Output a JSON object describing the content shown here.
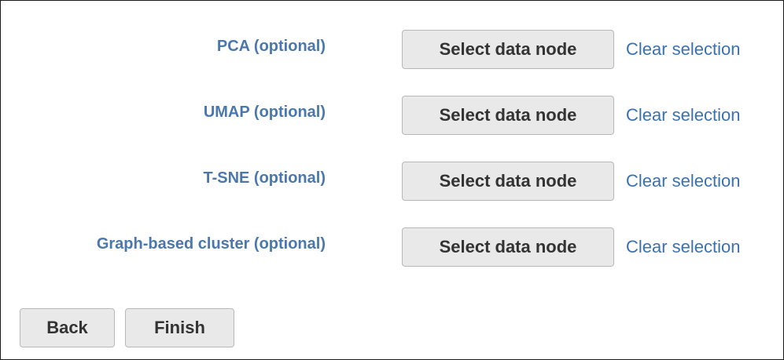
{
  "rows": [
    {
      "label": "PCA (optional)",
      "select_label": "Select data node",
      "clear_label": "Clear selection"
    },
    {
      "label": "UMAP (optional)",
      "select_label": "Select data node",
      "clear_label": "Clear selection"
    },
    {
      "label": "T-SNE (optional)",
      "select_label": "Select data node",
      "clear_label": "Clear selection"
    },
    {
      "label": "Graph-based cluster (optional)",
      "select_label": "Select data node",
      "clear_label": "Clear selection"
    }
  ],
  "footer": {
    "back_label": "Back",
    "finish_label": "Finish"
  },
  "colors": {
    "label_text": "#4a78ad",
    "link_text": "#3a72b0",
    "button_bg": "#e9e9e9",
    "button_text": "#333333"
  }
}
